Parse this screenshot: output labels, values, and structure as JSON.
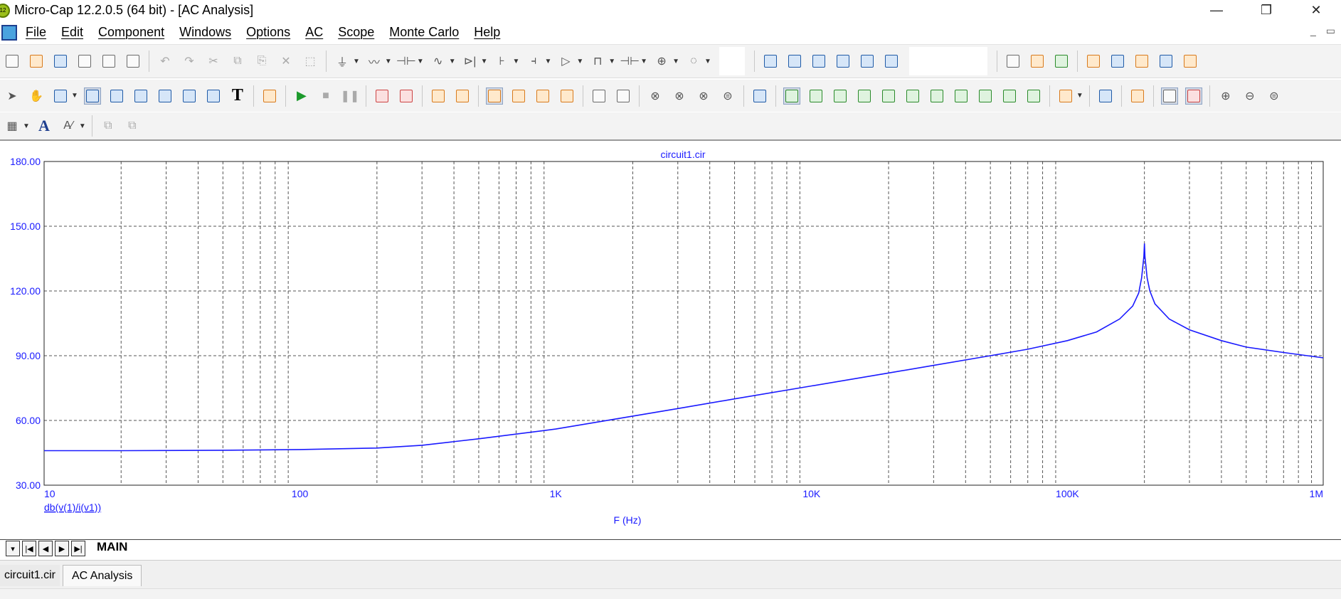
{
  "window": {
    "title": "Micro-Cap 12.2.0.5 (64 bit) - [AC Analysis]",
    "logo_text": "12",
    "minimize": "—",
    "maximize": "❐",
    "close": "✕"
  },
  "menu": {
    "items": [
      "File",
      "Edit",
      "Component",
      "Windows",
      "Options",
      "AC",
      "Scope",
      "Monte Carlo",
      "Help"
    ],
    "mdi_minimize": "_",
    "mdi_restore": "▭"
  },
  "toolbar": {
    "text_tool": "T",
    "font_tool": "A"
  },
  "plot": {
    "title": "circuit1.cir",
    "xlabel": "F (Hz)",
    "ylabel_expr": "db(v(1)/i(v1))"
  },
  "chart_data": {
    "type": "line",
    "title": "circuit1.cir",
    "xlabel": "F (Hz)",
    "ylabel": "db(v(1)/i(v1))",
    "x_scale": "log",
    "xlim": [
      10,
      1000000
    ],
    "ylim": [
      30,
      180
    ],
    "x_tick_labels": [
      "10",
      "100",
      "1K",
      "10K",
      "100K",
      "1M"
    ],
    "y_tick_labels": [
      "180.00",
      "150.00",
      "120.00",
      "90.00",
      "60.00",
      "30.00"
    ],
    "y_ticks": [
      180,
      150,
      120,
      90,
      60,
      30
    ],
    "grid": true,
    "line_color": "#1a1aff",
    "series": [
      {
        "x": [
          10,
          20,
          50,
          100,
          200,
          300,
          500,
          1000,
          2000,
          3000,
          5000,
          10000,
          20000,
          30000,
          50000,
          70000,
          100000,
          130000,
          160000,
          180000,
          190000,
          195000,
          199000,
          200000,
          201000,
          205000,
          210000,
          220000,
          250000,
          300000,
          400000,
          500000,
          700000,
          1000000
        ],
        "y": [
          46,
          46,
          46.2,
          46.5,
          47.2,
          48.5,
          51.5,
          56,
          62,
          65.5,
          70,
          76,
          82,
          85.5,
          90,
          93,
          97,
          101,
          107,
          113,
          119,
          126,
          136,
          142,
          136,
          126,
          120,
          114,
          107,
          102,
          97,
          94,
          91.5,
          89
        ]
      }
    ]
  },
  "page_tabs": {
    "nav": [
      "▾",
      "|◀",
      "◀",
      "▶",
      "▶|"
    ],
    "main": "MAIN"
  },
  "doc_tabs": [
    "circuit1.cir",
    "AC Analysis"
  ]
}
